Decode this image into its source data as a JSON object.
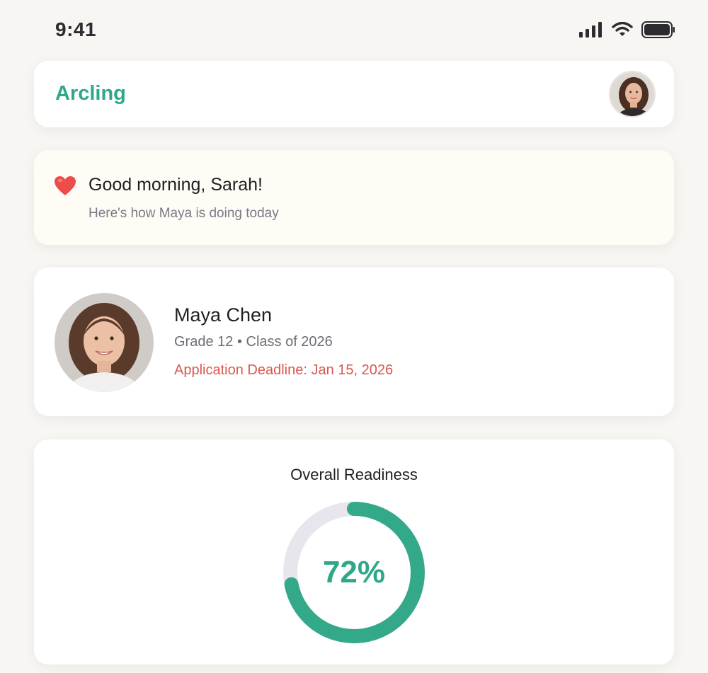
{
  "status_bar": {
    "time": "9:41",
    "icons": [
      "signal-icon",
      "wifi-icon",
      "battery-icon"
    ]
  },
  "header": {
    "brand": "Arcling",
    "avatar": "parent-avatar"
  },
  "greeting": {
    "icon": "heart-icon",
    "title": "Good morning, Sarah!",
    "subtitle": "Here's how Maya is doing today"
  },
  "student": {
    "name": "Maya Chen",
    "grade": "Grade 12 • Class of 2026",
    "deadline": "Application Deadline: Jan 15, 2026"
  },
  "readiness": {
    "title": "Overall Readiness",
    "percent_label": "72%",
    "progress": 0.72
  },
  "colors": {
    "brand": "#2fa889",
    "deadline": "#d9584d",
    "ring_track": "#e6e6ec",
    "ring_fill": "#34a98a",
    "background": "#f8f6f3"
  }
}
